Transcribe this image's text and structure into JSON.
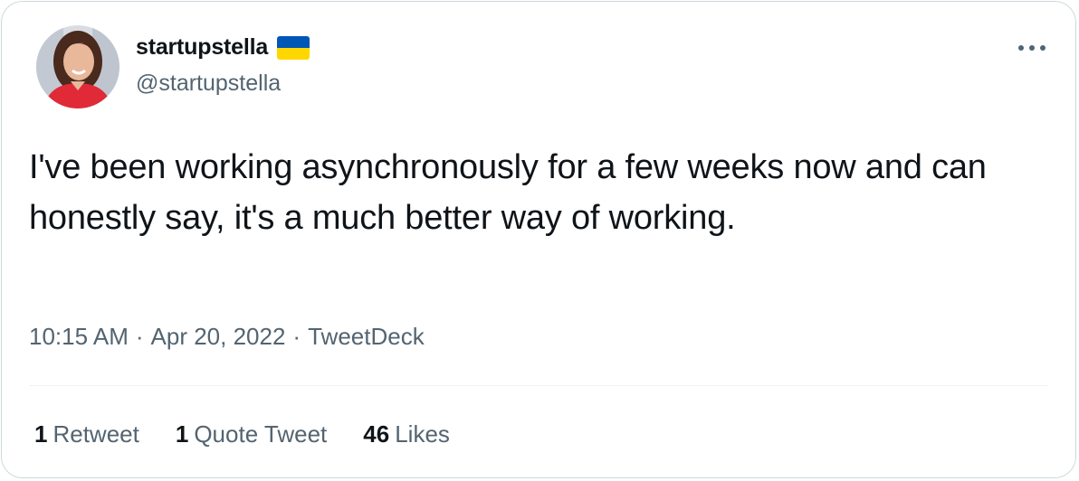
{
  "author": {
    "display_name": "startupstella",
    "handle": "@startupstella",
    "flag_icon": "ukraine-flag-icon"
  },
  "tweet": {
    "text": "I've been working asynchronously for a few weeks now and can honestly say, it's a much better way of working."
  },
  "meta": {
    "time": "10:15 AM",
    "separator": "·",
    "date": "Apr 20, 2022",
    "source": "TweetDeck"
  },
  "stats": {
    "retweets_count": "1",
    "retweets_label": "Retweet",
    "quotes_count": "1",
    "quotes_label": "Quote Tweet",
    "likes_count": "46",
    "likes_label": "Likes"
  },
  "colors": {
    "text_primary": "#0f1419",
    "text_secondary": "#536471",
    "border": "#cfd9de",
    "flag_blue": "#0057b7",
    "flag_yellow": "#ffd700"
  }
}
